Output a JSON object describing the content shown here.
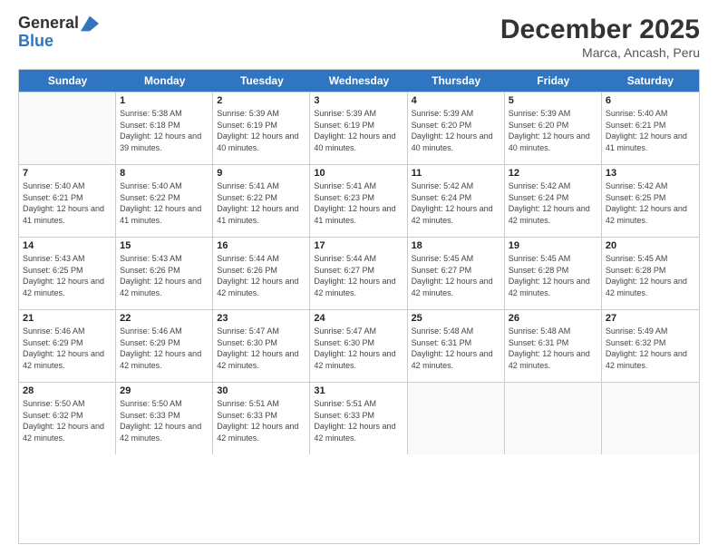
{
  "logo": {
    "line1": "General",
    "line2": "Blue"
  },
  "title": "December 2025",
  "subtitle": "Marca, Ancash, Peru",
  "days_of_week": [
    "Sunday",
    "Monday",
    "Tuesday",
    "Wednesday",
    "Thursday",
    "Friday",
    "Saturday"
  ],
  "weeks": [
    [
      {
        "day": "",
        "sunrise": "",
        "sunset": "",
        "daylight": "",
        "empty": true
      },
      {
        "day": "1",
        "sunrise": "Sunrise: 5:38 AM",
        "sunset": "Sunset: 6:18 PM",
        "daylight": "Daylight: 12 hours and 39 minutes."
      },
      {
        "day": "2",
        "sunrise": "Sunrise: 5:39 AM",
        "sunset": "Sunset: 6:19 PM",
        "daylight": "Daylight: 12 hours and 40 minutes."
      },
      {
        "day": "3",
        "sunrise": "Sunrise: 5:39 AM",
        "sunset": "Sunset: 6:19 PM",
        "daylight": "Daylight: 12 hours and 40 minutes."
      },
      {
        "day": "4",
        "sunrise": "Sunrise: 5:39 AM",
        "sunset": "Sunset: 6:20 PM",
        "daylight": "Daylight: 12 hours and 40 minutes."
      },
      {
        "day": "5",
        "sunrise": "Sunrise: 5:39 AM",
        "sunset": "Sunset: 6:20 PM",
        "daylight": "Daylight: 12 hours and 40 minutes."
      },
      {
        "day": "6",
        "sunrise": "Sunrise: 5:40 AM",
        "sunset": "Sunset: 6:21 PM",
        "daylight": "Daylight: 12 hours and 41 minutes."
      }
    ],
    [
      {
        "day": "7",
        "sunrise": "Sunrise: 5:40 AM",
        "sunset": "Sunset: 6:21 PM",
        "daylight": "Daylight: 12 hours and 41 minutes."
      },
      {
        "day": "8",
        "sunrise": "Sunrise: 5:40 AM",
        "sunset": "Sunset: 6:22 PM",
        "daylight": "Daylight: 12 hours and 41 minutes."
      },
      {
        "day": "9",
        "sunrise": "Sunrise: 5:41 AM",
        "sunset": "Sunset: 6:22 PM",
        "daylight": "Daylight: 12 hours and 41 minutes."
      },
      {
        "day": "10",
        "sunrise": "Sunrise: 5:41 AM",
        "sunset": "Sunset: 6:23 PM",
        "daylight": "Daylight: 12 hours and 41 minutes."
      },
      {
        "day": "11",
        "sunrise": "Sunrise: 5:42 AM",
        "sunset": "Sunset: 6:24 PM",
        "daylight": "Daylight: 12 hours and 42 minutes."
      },
      {
        "day": "12",
        "sunrise": "Sunrise: 5:42 AM",
        "sunset": "Sunset: 6:24 PM",
        "daylight": "Daylight: 12 hours and 42 minutes."
      },
      {
        "day": "13",
        "sunrise": "Sunrise: 5:42 AM",
        "sunset": "Sunset: 6:25 PM",
        "daylight": "Daylight: 12 hours and 42 minutes."
      }
    ],
    [
      {
        "day": "14",
        "sunrise": "Sunrise: 5:43 AM",
        "sunset": "Sunset: 6:25 PM",
        "daylight": "Daylight: 12 hours and 42 minutes."
      },
      {
        "day": "15",
        "sunrise": "Sunrise: 5:43 AM",
        "sunset": "Sunset: 6:26 PM",
        "daylight": "Daylight: 12 hours and 42 minutes."
      },
      {
        "day": "16",
        "sunrise": "Sunrise: 5:44 AM",
        "sunset": "Sunset: 6:26 PM",
        "daylight": "Daylight: 12 hours and 42 minutes."
      },
      {
        "day": "17",
        "sunrise": "Sunrise: 5:44 AM",
        "sunset": "Sunset: 6:27 PM",
        "daylight": "Daylight: 12 hours and 42 minutes."
      },
      {
        "day": "18",
        "sunrise": "Sunrise: 5:45 AM",
        "sunset": "Sunset: 6:27 PM",
        "daylight": "Daylight: 12 hours and 42 minutes."
      },
      {
        "day": "19",
        "sunrise": "Sunrise: 5:45 AM",
        "sunset": "Sunset: 6:28 PM",
        "daylight": "Daylight: 12 hours and 42 minutes."
      },
      {
        "day": "20",
        "sunrise": "Sunrise: 5:45 AM",
        "sunset": "Sunset: 6:28 PM",
        "daylight": "Daylight: 12 hours and 42 minutes."
      }
    ],
    [
      {
        "day": "21",
        "sunrise": "Sunrise: 5:46 AM",
        "sunset": "Sunset: 6:29 PM",
        "daylight": "Daylight: 12 hours and 42 minutes."
      },
      {
        "day": "22",
        "sunrise": "Sunrise: 5:46 AM",
        "sunset": "Sunset: 6:29 PM",
        "daylight": "Daylight: 12 hours and 42 minutes."
      },
      {
        "day": "23",
        "sunrise": "Sunrise: 5:47 AM",
        "sunset": "Sunset: 6:30 PM",
        "daylight": "Daylight: 12 hours and 42 minutes."
      },
      {
        "day": "24",
        "sunrise": "Sunrise: 5:47 AM",
        "sunset": "Sunset: 6:30 PM",
        "daylight": "Daylight: 12 hours and 42 minutes."
      },
      {
        "day": "25",
        "sunrise": "Sunrise: 5:48 AM",
        "sunset": "Sunset: 6:31 PM",
        "daylight": "Daylight: 12 hours and 42 minutes."
      },
      {
        "day": "26",
        "sunrise": "Sunrise: 5:48 AM",
        "sunset": "Sunset: 6:31 PM",
        "daylight": "Daylight: 12 hours and 42 minutes."
      },
      {
        "day": "27",
        "sunrise": "Sunrise: 5:49 AM",
        "sunset": "Sunset: 6:32 PM",
        "daylight": "Daylight: 12 hours and 42 minutes."
      }
    ],
    [
      {
        "day": "28",
        "sunrise": "Sunrise: 5:50 AM",
        "sunset": "Sunset: 6:32 PM",
        "daylight": "Daylight: 12 hours and 42 minutes."
      },
      {
        "day": "29",
        "sunrise": "Sunrise: 5:50 AM",
        "sunset": "Sunset: 6:33 PM",
        "daylight": "Daylight: 12 hours and 42 minutes."
      },
      {
        "day": "30",
        "sunrise": "Sunrise: 5:51 AM",
        "sunset": "Sunset: 6:33 PM",
        "daylight": "Daylight: 12 hours and 42 minutes."
      },
      {
        "day": "31",
        "sunrise": "Sunrise: 5:51 AM",
        "sunset": "Sunset: 6:33 PM",
        "daylight": "Daylight: 12 hours and 42 minutes."
      },
      {
        "day": "",
        "sunrise": "",
        "sunset": "",
        "daylight": "",
        "empty": true
      },
      {
        "day": "",
        "sunrise": "",
        "sunset": "",
        "daylight": "",
        "empty": true
      },
      {
        "day": "",
        "sunrise": "",
        "sunset": "",
        "daylight": "",
        "empty": true
      }
    ]
  ]
}
